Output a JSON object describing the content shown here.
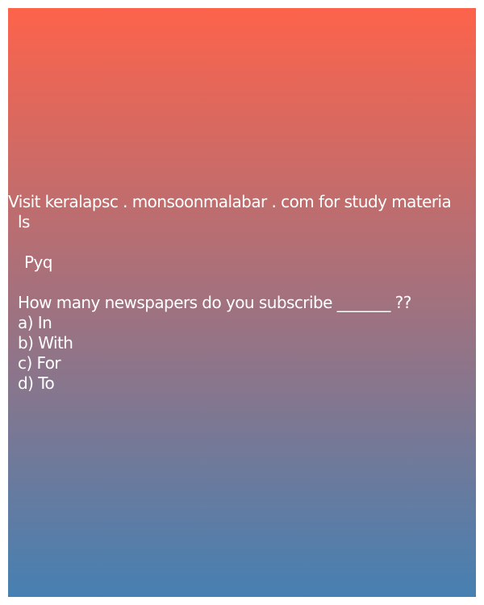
{
  "colors": {
    "gradient_top": "#fd634b",
    "gradient_bottom": "#4680b2",
    "text": "#ffffff"
  },
  "post": {
    "visit_line_1": "Visit keralapsc . monsoonmalabar . com for study materia",
    "visit_line_2": "ls",
    "tag": "Pyq",
    "question": "How many newspapers do you subscribe _______ ??",
    "options": [
      "a) In",
      "b) With",
      "c) For",
      "d) To"
    ]
  }
}
